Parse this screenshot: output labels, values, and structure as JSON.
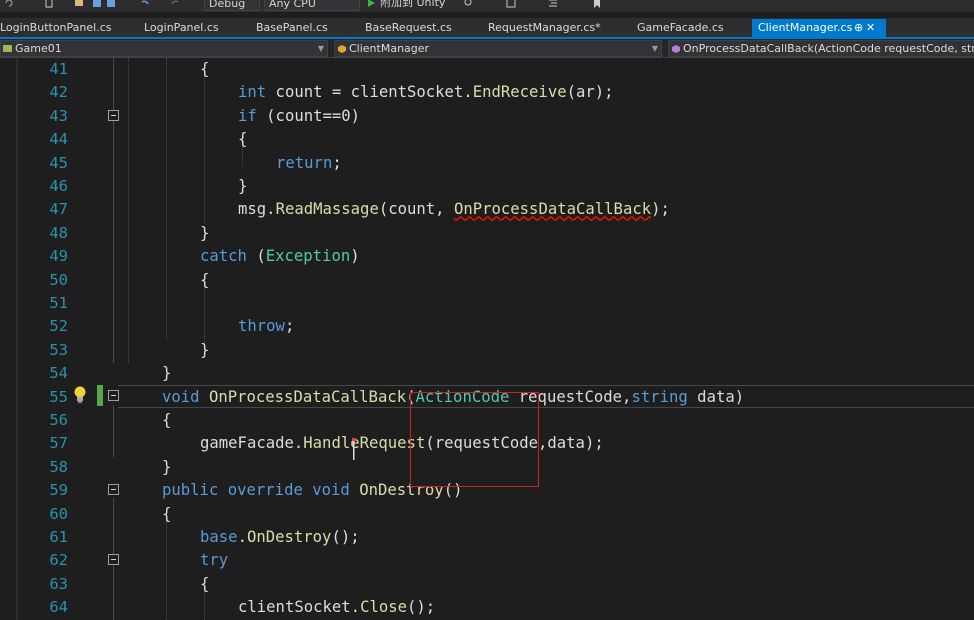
{
  "toolbar": {
    "config": "Debug",
    "platform": "Any CPU",
    "attach": "附加到 Unity"
  },
  "tabs": [
    {
      "label": "LoginButtonPanel.cs"
    },
    {
      "label": "LoginPanel.cs"
    },
    {
      "label": "BasePanel.cs"
    },
    {
      "label": "BaseRequest.cs"
    },
    {
      "label": "RequestManager.cs*"
    },
    {
      "label": "GameFacade.cs"
    },
    {
      "label": "ClientManager.cs",
      "pin": "⊕",
      "close": "✕"
    }
  ],
  "nav": {
    "project": "Game01",
    "type": "ClientManager",
    "member": "OnProcessDataCallBack(ActionCode requestCode, string d"
  },
  "lines": [
    {
      "n": "41",
      "t": [
        [
          "{",
          "id"
        ]
      ]
    },
    {
      "n": "42",
      "t": [
        [
          "int",
          "kw"
        ],
        [
          " count = clientSocket.",
          "id"
        ],
        [
          "EndReceive",
          "mt"
        ],
        [
          "(ar);",
          "id"
        ]
      ]
    },
    {
      "n": "43",
      "t": [
        [
          "if",
          "kw"
        ],
        [
          " (count==0)",
          "id"
        ]
      ]
    },
    {
      "n": "44",
      "t": [
        [
          "{",
          "id"
        ]
      ]
    },
    {
      "n": "45",
      "t": [
        [
          "return",
          "kw"
        ],
        [
          ";",
          "id"
        ]
      ]
    },
    {
      "n": "46",
      "t": [
        [
          "}",
          "id"
        ]
      ]
    },
    {
      "n": "47",
      "t": [
        [
          "msg.",
          "id"
        ],
        [
          "ReadMassage",
          "mt"
        ],
        [
          "(count, ",
          "id"
        ],
        [
          "OnProcessDataCallBack",
          "mtsq"
        ],
        [
          ");",
          "id"
        ]
      ]
    },
    {
      "n": "48",
      "t": [
        [
          "}",
          "id"
        ]
      ]
    },
    {
      "n": "49",
      "t": [
        [
          "catch",
          "kw"
        ],
        [
          " (",
          "id"
        ],
        [
          "Exception",
          "ty"
        ],
        [
          ")",
          "id"
        ]
      ]
    },
    {
      "n": "50",
      "t": [
        [
          "{",
          "id"
        ]
      ]
    },
    {
      "n": "51",
      "t": []
    },
    {
      "n": "52",
      "t": [
        [
          "throw",
          "kw"
        ],
        [
          ";",
          "id"
        ]
      ]
    },
    {
      "n": "53",
      "t": [
        [
          "}",
          "id"
        ]
      ]
    },
    {
      "n": "54",
      "t": [
        [
          "}",
          "id"
        ]
      ]
    },
    {
      "n": "55",
      "t": [
        [
          "void",
          "kw"
        ],
        [
          " ",
          "id"
        ],
        [
          "OnProcessDataCallBack",
          "mt"
        ],
        [
          "(",
          "id"
        ],
        [
          "ActionCode",
          "ty"
        ],
        [
          " requestCode,",
          "id"
        ],
        [
          "string",
          "kw"
        ],
        [
          " data)",
          "id"
        ]
      ]
    },
    {
      "n": "56",
      "t": [
        [
          "{",
          "id"
        ]
      ]
    },
    {
      "n": "57",
      "t": [
        [
          "gameFacade.",
          "id"
        ],
        [
          "HandleRequest",
          "mt"
        ],
        [
          "(requestCode,data);",
          "id"
        ]
      ]
    },
    {
      "n": "58",
      "t": [
        [
          "}",
          "id"
        ]
      ]
    },
    {
      "n": "59",
      "t": [
        [
          "public",
          "kw"
        ],
        [
          " ",
          "id"
        ],
        [
          "override",
          "kw"
        ],
        [
          " ",
          "id"
        ],
        [
          "void",
          "kw"
        ],
        [
          " ",
          "id"
        ],
        [
          "OnDestroy",
          "mt"
        ],
        [
          "()",
          "id"
        ]
      ]
    },
    {
      "n": "60",
      "t": [
        [
          "{",
          "id"
        ]
      ]
    },
    {
      "n": "61",
      "t": [
        [
          "base",
          "kw"
        ],
        [
          ".",
          "id"
        ],
        [
          "OnDestroy",
          "mt"
        ],
        [
          "();",
          "id"
        ]
      ]
    },
    {
      "n": "62",
      "t": [
        [
          "try",
          "kw"
        ]
      ]
    },
    {
      "n": "63",
      "t": [
        [
          "{",
          "id"
        ]
      ]
    },
    {
      "n": "64",
      "t": [
        [
          "clientSocket.",
          "id"
        ],
        [
          "Close",
          "mt"
        ],
        [
          "();",
          "id"
        ]
      ]
    }
  ],
  "colors": {
    "keyword": "#569cd6",
    "type": "#4ec9b0",
    "method": "#dcdcaa",
    "text": "#dcdcdc",
    "line_number": "#2b91af",
    "accent": "#007acc"
  }
}
